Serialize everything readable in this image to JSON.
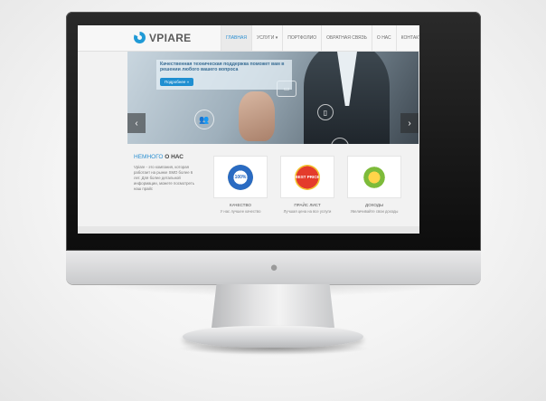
{
  "site": {
    "logo": "VPIARE",
    "nav": [
      {
        "label": "ГЛАВНАЯ",
        "active": true
      },
      {
        "label": "УСЛУГИ ▾",
        "active": false
      },
      {
        "label": "ПОРТФОЛИО",
        "active": false
      },
      {
        "label": "ОБРАТНАЯ СВЯЗЬ",
        "active": false
      },
      {
        "label": "О НАС",
        "active": false
      },
      {
        "label": "КОНТАКТЫ",
        "active": false
      }
    ]
  },
  "slider": {
    "caption": "Качественная техническая поддержка поможет вам в решении любого вашего вопроса",
    "button": "Подробнее »",
    "prev": "‹",
    "next": "›"
  },
  "about": {
    "title_prefix": "НЕМНОГО",
    "title_suffix": "О НАС",
    "text": "Vpiare - это компания, которая работает на рынке SMO более 6 лет. Для более детальной информации, можете посмотреть наш прайс"
  },
  "features": [
    {
      "badge": "100%",
      "label": "КАЧЕСТВО",
      "desc": "У нас лучшее качество"
    },
    {
      "badge": "BEST PRICE",
      "label": "ПРАЙС ЛИСТ",
      "desc": "Лучшая цена на все услуги"
    },
    {
      "badge": "",
      "label": "ДОХОДЫ",
      "desc": "Увеличивайте свои доходы"
    }
  ],
  "colors": {
    "accent": "#2b8fd1",
    "bezel": "#111111"
  },
  "icons": {
    "apple": "apple-logo-icon"
  }
}
